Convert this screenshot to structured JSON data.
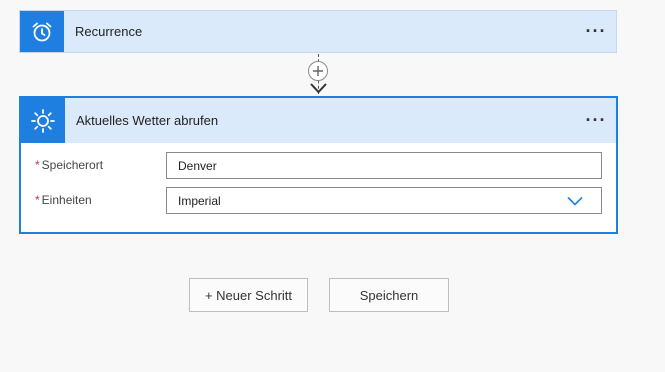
{
  "recurrence": {
    "title": "Recurrence",
    "icon": "alarm-clock-icon",
    "more": "···"
  },
  "weather": {
    "title": "Aktuelles Wetter abrufen",
    "icon": "sun-icon",
    "more": "···",
    "fields": [
      {
        "required": "*",
        "label": "Speicherort",
        "value": "Denver"
      },
      {
        "required": "*",
        "label": "Einheiten",
        "value": "Imperial"
      }
    ]
  },
  "connector": {
    "plus_icon": "plus-icon",
    "arrow_icon": "arrow-down-icon"
  },
  "actions": {
    "new_step": "+ Neuer Schritt",
    "save": "Speichern"
  },
  "colors": {
    "accent": "#1e7fe0",
    "header_bg": "#dbeafb",
    "required": "#c23934"
  }
}
